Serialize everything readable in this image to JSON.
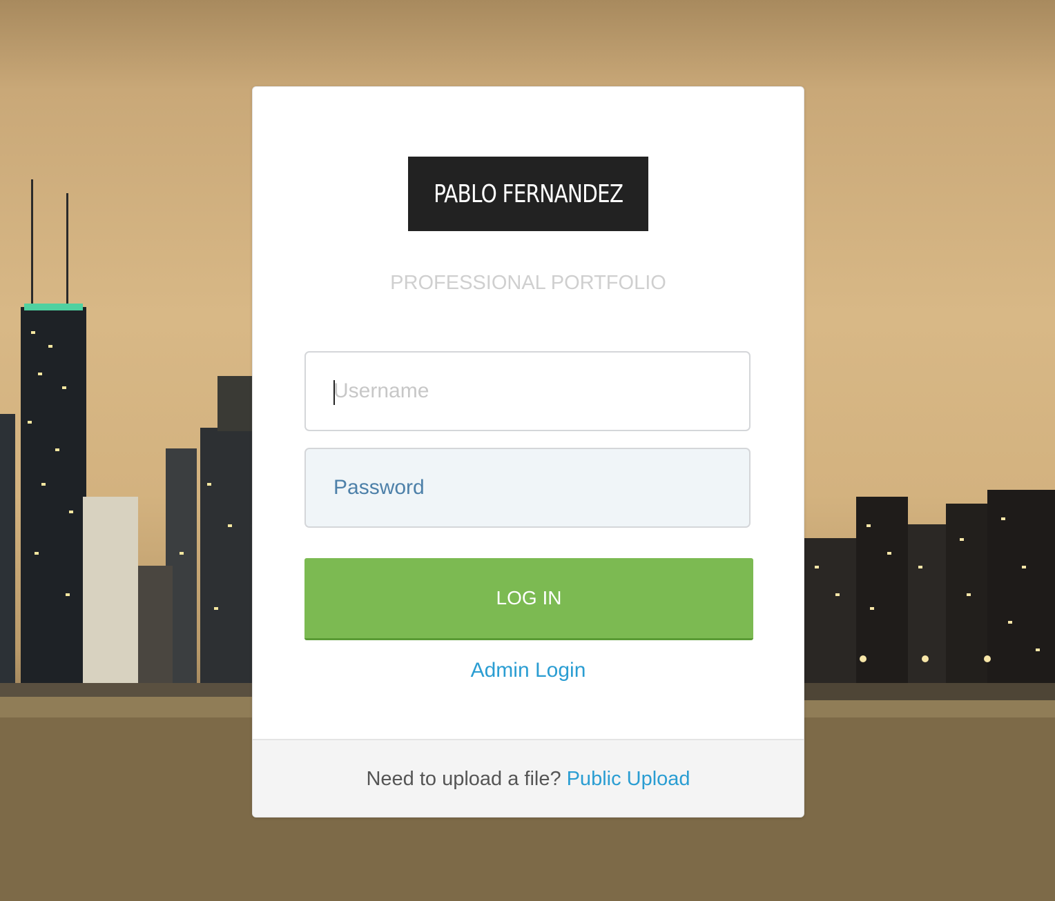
{
  "brand": {
    "name": "PABLO FERNANDEZ",
    "tagline": "PROFESSIONAL PORTFOLIO"
  },
  "form": {
    "username": {
      "value": "",
      "placeholder": "Username"
    },
    "password": {
      "value": "",
      "placeholder": "Password"
    },
    "login_label": "LOG IN",
    "admin_link": "Admin Login"
  },
  "footer": {
    "prompt": "Need to upload a file?",
    "link": "Public Upload"
  },
  "colors": {
    "login_button": "#7cba52",
    "link": "#2a9dd2",
    "logo_bg": "#222222"
  }
}
